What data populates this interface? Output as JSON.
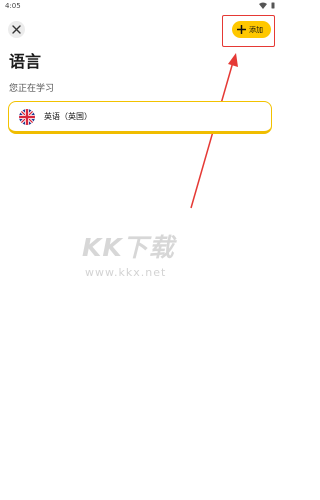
{
  "status_bar": {
    "time": "4:05",
    "icons": [
      "wifi-icon",
      "battery-icon"
    ]
  },
  "header": {
    "close_icon": "close-icon",
    "add_label": "添加",
    "add_icon": "plus-icon"
  },
  "page": {
    "title": "语言",
    "section_label": "您正在学习"
  },
  "languages": [
    {
      "name": "英语（英国）",
      "flag": "uk-flag-icon"
    }
  ],
  "watermark": {
    "logo": "KK下载",
    "url": "www.kkx.net"
  },
  "colors": {
    "accent": "#ffc800",
    "annotation": "#e53935",
    "card_border": "#f2c200"
  }
}
